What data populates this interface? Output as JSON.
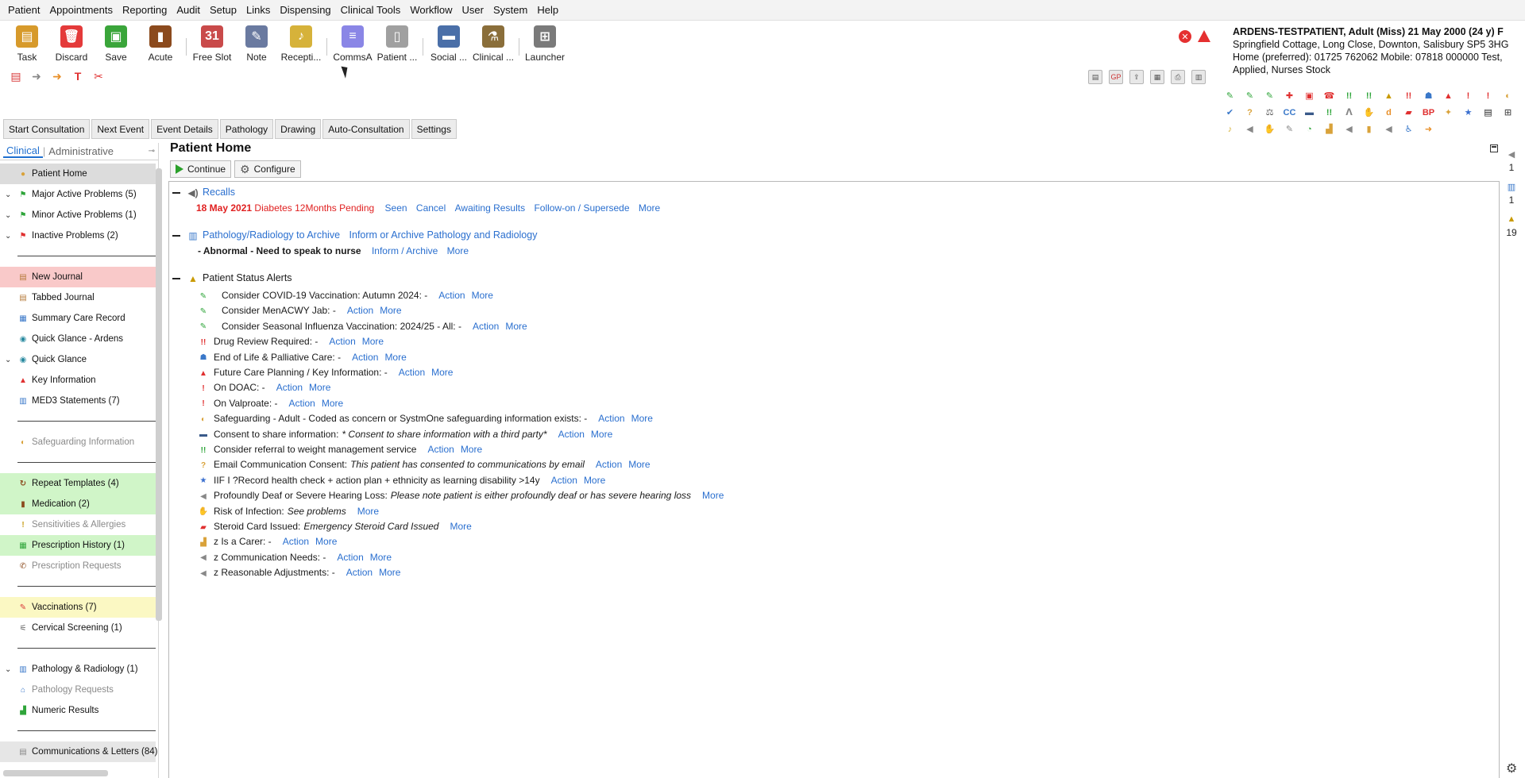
{
  "menu": [
    "Patient",
    "Appointments",
    "Reporting",
    "Audit",
    "Setup",
    "Links",
    "Dispensing",
    "Clinical Tools",
    "Workflow",
    "User",
    "System",
    "Help"
  ],
  "toolbar": [
    {
      "label": "Task",
      "icon": "clipboard-icon",
      "color": "#d79a2b"
    },
    {
      "label": "Discard",
      "icon": "trash-icon",
      "color": "#e43a3a"
    },
    {
      "label": "Save",
      "icon": "floppy-icon",
      "color": "#3aa53a"
    },
    {
      "label": "Acute",
      "icon": "bottle-icon",
      "color": "#8b4a1d"
    },
    {
      "label": "Free Slot",
      "icon": "calendar-icon",
      "color": "#c94a4a"
    },
    {
      "label": "Note",
      "icon": "pen-icon",
      "color": "#6a7aa0"
    },
    {
      "label": "Recepti...",
      "icon": "bell-icon",
      "color": "#d6b23a"
    },
    {
      "label": "CommsA",
      "icon": "chat-icon",
      "color": "#8a86e6"
    },
    {
      "label": "Patient ...",
      "icon": "device-icon",
      "color": "#a0a0a0"
    },
    {
      "label": "Social ...",
      "icon": "bus-icon",
      "color": "#4a6fa8"
    },
    {
      "label": "Clinical ...",
      "icon": "flask-icon",
      "color": "#8a6e3a"
    },
    {
      "label": "Launcher",
      "icon": "launcher-icon",
      "color": "#7a7a7a"
    }
  ],
  "patient": {
    "name": "ARDENS-TESTPATIENT, Adult (Miss) 21 May 2000 (24 y) F",
    "address": "Springfield Cottage, Long Close, Downton, Salisbury SP5 3HG",
    "phone": "Home (preferred): 01725 762062 Mobile: 07818 000000   Test,",
    "extra": "Applied, Nurses Stock"
  },
  "action_tabs": [
    "Start Consultation",
    "Next Event",
    "Event Details",
    "Pathology",
    "Drawing",
    "Auto-Consultation",
    "Settings"
  ],
  "left_tabs": {
    "clinical": "Clinical",
    "administrative": "Administrative"
  },
  "nav": [
    {
      "label": "Patient Home",
      "style": "sel",
      "icon": "person-icon",
      "icolor": "#d9a23a",
      "chev": ""
    },
    {
      "label": "Major Active Problems (5)",
      "style": "",
      "icon": "green-flag-icon",
      "icolor": "#2fa53a",
      "chev": "v"
    },
    {
      "label": "Minor Active Problems (1)",
      "style": "",
      "icon": "green-flag-icon",
      "icolor": "#2fa53a",
      "chev": "v"
    },
    {
      "label": "Inactive Problems (2)",
      "style": "",
      "icon": "red-flag-icon",
      "icolor": "#e03030",
      "chev": "v"
    },
    {
      "divider": true
    },
    {
      "label": "New Journal",
      "style": "pink",
      "icon": "journal-icon",
      "icolor": "#b57a3a",
      "chev": ""
    },
    {
      "label": "Tabbed Journal",
      "style": "",
      "icon": "journal-icon",
      "icolor": "#b57a3a",
      "chev": ""
    },
    {
      "label": "Summary Care Record",
      "style": "",
      "icon": "record-icon",
      "icolor": "#3a78c9",
      "chev": ""
    },
    {
      "label": "Quick Glance - Ardens",
      "style": "",
      "icon": "eye-icon",
      "icolor": "#2a8aa0",
      "chev": ""
    },
    {
      "label": "Quick Glance",
      "style": "",
      "icon": "eye-icon",
      "icolor": "#2a8aa0",
      "chev": "v"
    },
    {
      "label": "Key Information",
      "style": "",
      "icon": "warning-icon",
      "icolor": "#e03030",
      "chev": ""
    },
    {
      "label": "MED3 Statements (7)",
      "style": "",
      "icon": "med3-icon",
      "icolor": "#3a78c9",
      "chev": ""
    },
    {
      "divider": true
    },
    {
      "label": "Safeguarding Information",
      "style": "dim",
      "icon": "safeguard-icon",
      "icolor": "#d9a23a",
      "chev": ""
    },
    {
      "divider": true
    },
    {
      "label": "Repeat Templates (4)",
      "style": "green",
      "icon": "repeat-icon",
      "icolor": "#8b4a1d",
      "chev": ""
    },
    {
      "label": "Medication (2)",
      "style": "green",
      "icon": "bottle-icon",
      "icolor": "#8b4a1d",
      "chev": ""
    },
    {
      "label": "Sensitivities & Allergies",
      "style": "dim",
      "icon": "allergy-icon",
      "icolor": "#c9a020",
      "chev": ""
    },
    {
      "label": "Prescription History (1)",
      "style": "green",
      "icon": "rx-history-icon",
      "icolor": "#2fa53a",
      "chev": ""
    },
    {
      "label": "Prescription Requests",
      "style": "dim",
      "icon": "rx-request-icon",
      "icolor": "#8b4a1d",
      "chev": ""
    },
    {
      "divider": true
    },
    {
      "label": "Vaccinations (7)",
      "style": "yellow",
      "icon": "syringe-icon",
      "icolor": "#d93a3a",
      "chev": ""
    },
    {
      "label": "Cervical Screening (1)",
      "style": "",
      "icon": "screening-icon",
      "icolor": "#555555",
      "chev": ""
    },
    {
      "divider": true
    },
    {
      "label": "Pathology & Radiology (1)",
      "style": "",
      "icon": "test-tubes-icon",
      "icolor": "#3a78c9",
      "chev": "v"
    },
    {
      "label": "Pathology Requests",
      "style": "dim",
      "icon": "request-icon",
      "icolor": "#3a78c9",
      "chev": ""
    },
    {
      "label": "Numeric Results",
      "style": "",
      "icon": "graph-icon",
      "icolor": "#2fa53a",
      "chev": ""
    },
    {
      "divider": true
    },
    {
      "label": "Communications & Letters (84)",
      "style": "grey",
      "icon": "letters-icon",
      "icolor": "#888888",
      "chev": ""
    }
  ],
  "main": {
    "title": "Patient Home",
    "continue_label": "Continue",
    "configure_label": "Configure",
    "recalls": {
      "title": "Recalls",
      "date": "18 May 2021",
      "text": "Diabetes 12Months Pending",
      "links": [
        "Seen",
        "Cancel",
        "Awaiting Results",
        "Follow-on / Supersede",
        "More"
      ]
    },
    "pathology": {
      "title": "Pathology/Radiology to Archive",
      "link": "Inform or Archive Pathology and Radiology",
      "item": "- Abnormal - Need to speak to nurse",
      "item_links": [
        "Inform / Archive",
        "More"
      ]
    },
    "alerts_title": "Patient Status Alerts",
    "alerts": [
      {
        "icon": "vaccine-icon",
        "icolor": "#2fa53a",
        "label": "Consider COVID-19 Vaccination: Autumn 2024: -",
        "note": "",
        "links": [
          "Action",
          "More"
        ],
        "indent": 1
      },
      {
        "icon": "vaccine-icon",
        "icolor": "#2fa53a",
        "label": "Consider MenACWY Jab: -",
        "note": "",
        "links": [
          "Action",
          "More"
        ],
        "indent": 1
      },
      {
        "icon": "vaccine-icon",
        "icolor": "#2fa53a",
        "label": "Consider Seasonal Influenza Vaccination: 2024/25 - All: -",
        "note": "",
        "links": [
          "Action",
          "More"
        ],
        "indent": 1
      },
      {
        "icon": "double-exclaim-red-icon",
        "icolor": "#e03030",
        "label": "Drug Review Required: -",
        "note": "",
        "links": [
          "Action",
          "More"
        ],
        "indent": 0
      },
      {
        "icon": "palliative-icon",
        "icolor": "#3a78c9",
        "label": "End of Life & Palliative Care: -",
        "note": "",
        "links": [
          "Action",
          "More"
        ],
        "indent": 0
      },
      {
        "icon": "warning-icon",
        "icolor": "#e03030",
        "label": "Future Care Planning / Key Information: -",
        "note": "",
        "links": [
          "Action",
          "More"
        ],
        "indent": 0
      },
      {
        "icon": "stop-icon",
        "icolor": "#e03030",
        "label": "On DOAC: -",
        "note": "",
        "links": [
          "Action",
          "More"
        ],
        "indent": 0
      },
      {
        "icon": "stop-icon",
        "icolor": "#e03030",
        "label": "On Valproate: -",
        "note": "",
        "links": [
          "Action",
          "More"
        ],
        "indent": 0
      },
      {
        "icon": "safeguard-icon",
        "icolor": "#d9a23a",
        "label": "Safeguarding - Adult - Coded as concern or SystmOne safeguarding information exists: -",
        "note": "",
        "links": [
          "Action",
          "More"
        ],
        "indent": 0
      },
      {
        "icon": "consent-icon",
        "icolor": "#3a5a8a",
        "label": "Consent to share information:",
        "note": "* Consent to share information with a third party*",
        "links": [
          "Action",
          "More"
        ],
        "indent": 0
      },
      {
        "icon": "double-exclaim-green-icon",
        "icolor": "#2fa53a",
        "label": "Consider referral to weight management service",
        "note": "",
        "links": [
          "Action",
          "More"
        ],
        "indent": 0
      },
      {
        "icon": "email-consent-icon",
        "icolor": "#d9a23a",
        "label": "Email Communication Consent:",
        "note": "This patient has consented to communications by email",
        "links": [
          "Action",
          "More"
        ],
        "indent": 0
      },
      {
        "icon": "star-icon",
        "icolor": "#3a6fcf",
        "label": "IIF I ?Record health check + action plan + ethnicity as learning disability >14y",
        "note": "",
        "links": [
          "Action",
          "More"
        ],
        "indent": 0
      },
      {
        "icon": "speaker-icon",
        "icolor": "#888888",
        "label": "Profoundly Deaf or Severe Hearing Loss:",
        "note": "Please note patient is either profoundly deaf or has severe hearing loss",
        "links": [
          "More"
        ],
        "indent": 0
      },
      {
        "icon": "hand-icon",
        "icolor": "#999999",
        "label": "Risk of Infection:",
        "note": "See problems",
        "links": [
          "More"
        ],
        "indent": 0
      },
      {
        "icon": "steroid-card-icon",
        "icolor": "#e03030",
        "label": "Steroid Card Issued:",
        "note": "Emergency Steroid Card Issued",
        "links": [
          "More"
        ],
        "indent": 0
      },
      {
        "icon": "carer-icon",
        "icolor": "#d9a23a",
        "label": "z  Is a Carer: -",
        "note": "",
        "links": [
          "Action",
          "More"
        ],
        "indent": 0
      },
      {
        "icon": "speaker-icon",
        "icolor": "#888888",
        "label": "z Communication Needs: -",
        "note": "",
        "links": [
          "Action",
          "More"
        ],
        "indent": 0
      },
      {
        "icon": "speaker-icon",
        "icolor": "#888888",
        "label": "z Reasonable Adjustments: -",
        "note": "",
        "links": [
          "Action",
          "More"
        ],
        "indent": 0
      }
    ]
  },
  "rail": [
    {
      "icon": "speaker-icon",
      "count": "1"
    },
    {
      "icon": "test-tubes-icon",
      "count": "1"
    },
    {
      "icon": "warning-yellow-icon",
      "count": "19"
    }
  ]
}
